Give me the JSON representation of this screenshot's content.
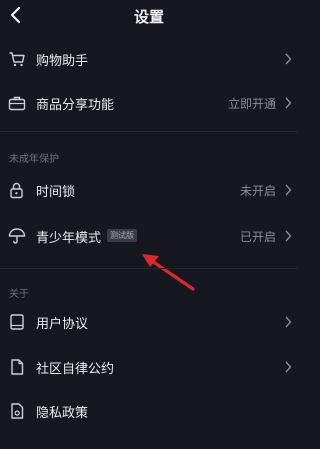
{
  "header": {
    "title": "设置"
  },
  "items": {
    "shopping_assistant": {
      "label": "购物助手"
    },
    "product_share": {
      "label": "商品分享功能",
      "value": "立即开通"
    },
    "time_lock": {
      "label": "时间锁",
      "value": "未开启"
    },
    "youth_mode": {
      "label": "青少年模式",
      "badge": "测试版",
      "value": "已开启"
    },
    "user_agreement": {
      "label": "用户协议"
    },
    "community_rules": {
      "label": "社区自律公约"
    },
    "privacy_policy": {
      "label": "隐私政策"
    }
  },
  "sections": {
    "minor_protection": "未成年保护",
    "about": "关于"
  },
  "colors": {
    "background": "#16181f",
    "arrow": "#e0262b",
    "secondary_text": "#8c8e97"
  },
  "icons": [
    "back-icon",
    "cart-icon",
    "briefcase-icon",
    "lock-icon",
    "umbrella-icon",
    "book-icon",
    "document-icon",
    "privacy-document-icon",
    "chevron-right-icon"
  ]
}
